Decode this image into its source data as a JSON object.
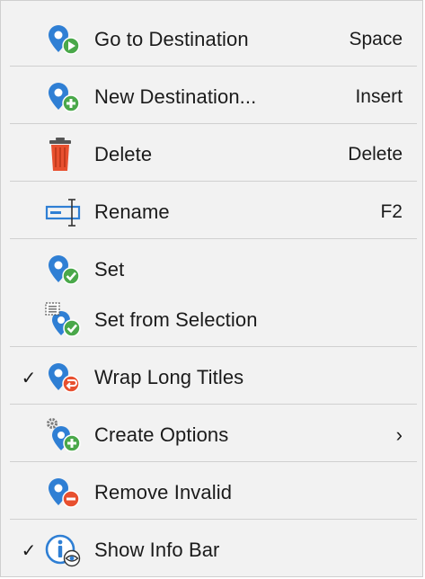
{
  "menu": {
    "items": [
      {
        "label": "Go to Destination",
        "shortcut": "Space",
        "icon": "pin-play-icon"
      },
      {
        "label": "New Destination...",
        "shortcut": "Insert",
        "icon": "pin-add-icon"
      },
      {
        "label": "Delete",
        "shortcut": "Delete",
        "icon": "trash-icon"
      },
      {
        "label": "Rename",
        "shortcut": "F2",
        "icon": "rename-icon"
      },
      {
        "label": "Set",
        "shortcut": "",
        "icon": "pin-check-icon"
      },
      {
        "label": "Set from Selection",
        "shortcut": "",
        "icon": "pin-selection-check-icon"
      },
      {
        "label": "Wrap Long Titles",
        "shortcut": "",
        "icon": "pin-wrap-icon",
        "checked": true,
        "check_glyph": "✓"
      },
      {
        "label": "Create Options",
        "shortcut": "",
        "icon": "pin-gear-add-icon",
        "submenu_glyph": "›"
      },
      {
        "label": "Remove Invalid",
        "shortcut": "",
        "icon": "pin-remove-icon"
      },
      {
        "label": "Show Info Bar",
        "shortcut": "",
        "icon": "info-eye-icon",
        "checked": true,
        "check_glyph": "✓"
      }
    ]
  },
  "colors": {
    "pin_blue": "#2f7fd4",
    "pin_blue_light": "#5aa9ef",
    "green": "#4aa84a",
    "red": "#e8502f",
    "text": "#1b1b1b",
    "background": "#f2f2f2",
    "separator": "#d0d0d0"
  }
}
